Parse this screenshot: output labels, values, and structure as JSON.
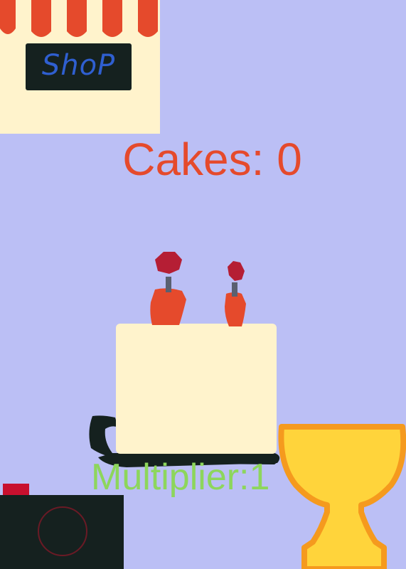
{
  "shop": {
    "sign_label": "ShoP",
    "awning_colors": [
      "#e54a2c",
      "#fff3cc"
    ]
  },
  "score": {
    "label": "Cakes: 0"
  },
  "multiplier": {
    "label": "Multiplier:1"
  },
  "icons": {
    "shop": "shop-awning-icon",
    "cake": "cake-icon",
    "camera": "camera-icon",
    "trophy": "trophy-icon"
  },
  "colors": {
    "background": "#bbbff5",
    "score_text": "#e54a2c",
    "multiplier_text": "#8dd65c",
    "cake_body": "#fff3cc",
    "trophy_gold": "#ffd43b"
  }
}
